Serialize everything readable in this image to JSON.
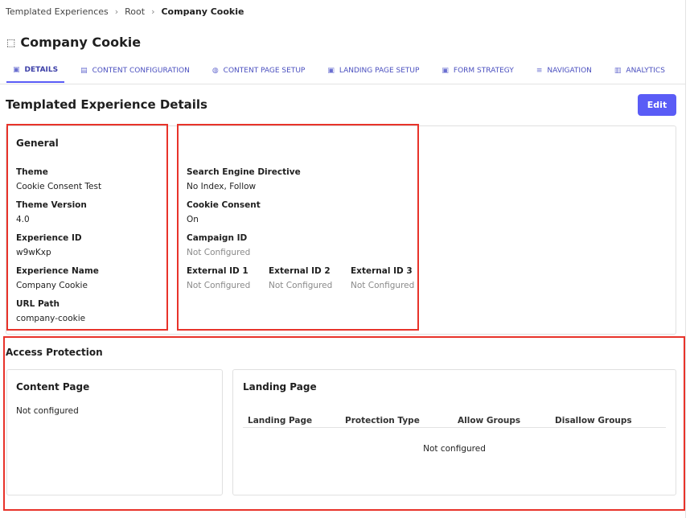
{
  "breadcrumb": [
    "Templated Experiences",
    "Root",
    "Company Cookie"
  ],
  "page_title": "Company Cookie",
  "tabs": [
    {
      "label": "DETAILS",
      "icon": "image-icon",
      "active": true
    },
    {
      "label": "CONTENT CONFIGURATION",
      "icon": "document-icon"
    },
    {
      "label": "CONTENT PAGE SETUP",
      "icon": "palette-icon"
    },
    {
      "label": "LANDING PAGE SETUP",
      "icon": "page-icon"
    },
    {
      "label": "FORM STRATEGY",
      "icon": "form-icon"
    },
    {
      "label": "NAVIGATION",
      "icon": "menu-icon"
    },
    {
      "label": "ANALYTICS",
      "icon": "chart-icon"
    }
  ],
  "section_title": "Templated Experience Details",
  "edit_label": "Edit",
  "general": {
    "title": "General",
    "fields": [
      {
        "label": "Theme",
        "value": "Cookie Consent Test"
      },
      {
        "label": "Theme Version",
        "value": "4.0"
      },
      {
        "label": "Experience ID",
        "value": "w9wKxp"
      },
      {
        "label": "Experience Name",
        "value": "Company Cookie"
      },
      {
        "label": "URL Path",
        "value": "company-cookie"
      }
    ]
  },
  "settings": {
    "fields": [
      {
        "label": "Search Engine Directive",
        "value": "No Index, Follow"
      },
      {
        "label": "Cookie Consent",
        "value": "On"
      },
      {
        "label": "Campaign ID",
        "value": "Not Configured"
      }
    ],
    "external": [
      {
        "label": "External ID 1",
        "value": "Not Configured"
      },
      {
        "label": "External ID 2",
        "value": "Not Configured"
      },
      {
        "label": "External ID 3",
        "value": "Not Configured"
      }
    ]
  },
  "access": {
    "title": "Access Protection",
    "content_page": {
      "title": "Content Page",
      "value": "Not configured"
    },
    "landing_page": {
      "title": "Landing Page",
      "columns": [
        "Landing Page",
        "Protection Type",
        "Allow Groups",
        "Disallow Groups"
      ],
      "empty": "Not configured"
    }
  },
  "colors": {
    "accent": "#5a5cf6",
    "highlight": "#e8332a"
  }
}
